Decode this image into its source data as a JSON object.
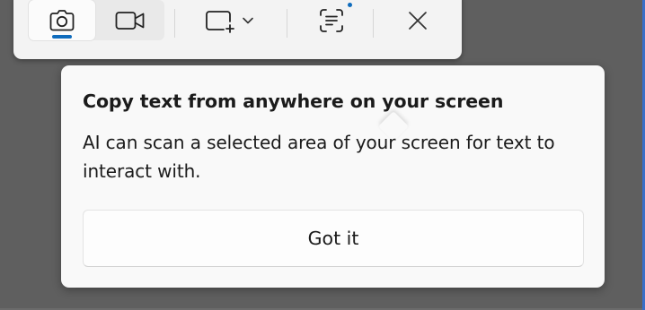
{
  "colors": {
    "backdrop": "#5f5f5f",
    "accent": "#0f6cbd",
    "surface": "#f3f3f3"
  },
  "toolbar": {
    "modes": [
      {
        "icon": "camera-icon",
        "selected": true
      },
      {
        "icon": "video-camera-icon",
        "selected": false
      }
    ],
    "shape_icon": "rectangle-snip-icon",
    "dropdown_icon": "chevron-down-icon",
    "text_actions_icon": "text-actions-icon",
    "close_icon": "close-icon"
  },
  "tip": {
    "title": "Copy text from anywhere on your screen",
    "body": "AI can scan a selected area of your screen for text to interact with.",
    "button_label": "Got it"
  }
}
